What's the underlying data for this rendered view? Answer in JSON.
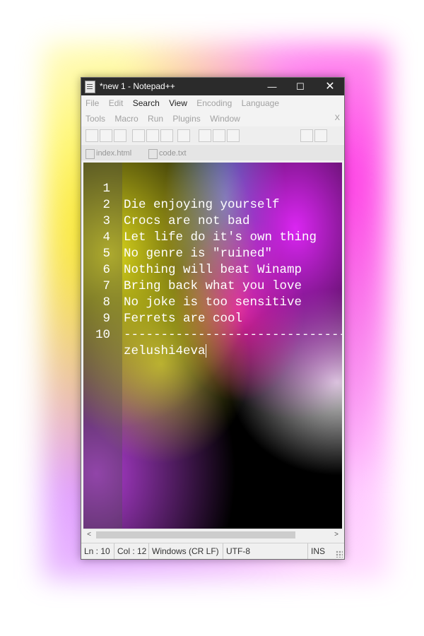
{
  "window": {
    "title": "*new 1 - Notepad++",
    "min_label": "—",
    "max_label": "☐",
    "close_label": "✕"
  },
  "menu": {
    "row1": [
      "File",
      "Edit",
      "Search",
      "View",
      "Encoding",
      "Language"
    ],
    "row2": [
      "Tools",
      "Macro",
      "Run",
      "Plugins",
      "Window"
    ],
    "close": "X"
  },
  "tabs": [
    "index.html",
    "code.txt"
  ],
  "editor": {
    "lines": [
      {
        "num": "1",
        "text": "Die enjoying yourself"
      },
      {
        "num": "2",
        "text": "Crocs are not bad"
      },
      {
        "num": "3",
        "text": "Let life do it's own thing"
      },
      {
        "num": "4",
        "text": "No genre is \"ruined\""
      },
      {
        "num": "5",
        "text": "Nothing will beat Winamp"
      },
      {
        "num": "6",
        "text": "Bring back what you love"
      },
      {
        "num": "7",
        "text": "No joke is too sensitive"
      },
      {
        "num": "8",
        "text": "Ferrets are cool"
      },
      {
        "num": "9",
        "text": "------------------------------"
      },
      {
        "num": "10",
        "text": "zelushi4eva"
      }
    ]
  },
  "scrollbar": {
    "left_arrow": "<",
    "right_arrow": ">"
  },
  "status": {
    "line": "Ln : 10",
    "col": "Col : 12",
    "eol": "Windows (CR LF)",
    "encoding": "UTF-8",
    "mode": "INS"
  }
}
